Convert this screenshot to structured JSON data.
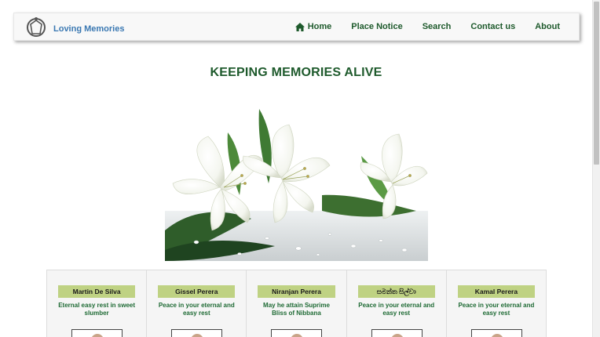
{
  "site": {
    "brand": "Loving Memories"
  },
  "nav": {
    "home": "Home",
    "place_notice": "Place Notice",
    "search": "Search",
    "contact": "Contact us",
    "about": "About"
  },
  "main": {
    "headline": "KEEPING MEMORIES ALIVE"
  },
  "notices": [
    {
      "name": "Martin De Silva",
      "message": "Eternal easy rest in sweet slumber"
    },
    {
      "name": "Gissel Perera",
      "message": "Peace in your eternal and easy rest"
    },
    {
      "name": "Niranjan Perera",
      "message": "May he attain Suprime Bliss of Nibbana"
    },
    {
      "name": "සමන්ත සිල්වා",
      "message": "Peace in your eternal and easy rest"
    },
    {
      "name": "Kamal Perera",
      "message": "Peace in your eternal and easy rest"
    }
  ],
  "colors": {
    "nav_text": "#1e5a2c",
    "brand_text": "#3a78b2",
    "name_bg": "#bfd283",
    "message_text": "#1e6a34"
  },
  "icons": {
    "logo": "shield-ring-logo",
    "home": "home-icon"
  }
}
